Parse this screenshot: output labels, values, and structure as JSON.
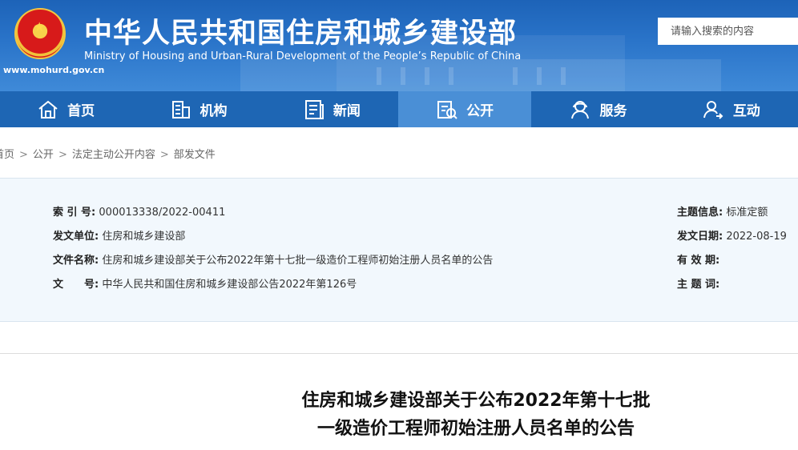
{
  "header": {
    "title_cn": "中华人民共和国住房和城乡建设部",
    "title_en": "Ministry of Housing and Urban-Rural Development of the People’s Republic of China",
    "url": "www.mohurd.gov.cn",
    "emblem_icon": "national-emblem-icon",
    "search_placeholder": "请输入搜索的内容"
  },
  "nav": {
    "items": [
      {
        "label": "首页",
        "icon": "home-icon"
      },
      {
        "label": "机构",
        "icon": "building-icon"
      },
      {
        "label": "新闻",
        "icon": "news-icon"
      },
      {
        "label": "公开",
        "icon": "disclosure-icon",
        "active": true
      },
      {
        "label": "服务",
        "icon": "service-icon"
      },
      {
        "label": "互动",
        "icon": "interact-icon"
      }
    ]
  },
  "breadcrumb": [
    "首页",
    "公开",
    "法定主动公开内容",
    "部发文件"
  ],
  "meta": {
    "index_label": "索 引 号:",
    "index_value": "000013338/2022-00411",
    "issuer_label": "发文单位:",
    "issuer_value": "住房和城乡建设部",
    "name_label": "文件名称:",
    "name_value": "住房和城乡建设部关于公布2022年第十七批一级造价工程师初始注册人员名单的公告",
    "docno_label": "文　　号:",
    "docno_value": "中华人民共和国住房和城乡建设部公告2022年第126号",
    "topic_label": "主题信息:",
    "topic_value": "标准定额",
    "date_label": "发文日期:",
    "date_value": "2022-08-19",
    "validity_label": "有 效 期:",
    "validity_value": "",
    "keywords_label": "主 题 词:",
    "keywords_value": ""
  },
  "article": {
    "title_line1": "住房和城乡建设部关于公布2022年第十七批",
    "title_line2": "一级造价工程师初始注册人员名单的公告"
  },
  "colors": {
    "header_blue": "#2a74c9",
    "nav_blue": "#1e66b4",
    "nav_active": "#4a8fd6",
    "meta_bg": "#f2f8fd"
  }
}
